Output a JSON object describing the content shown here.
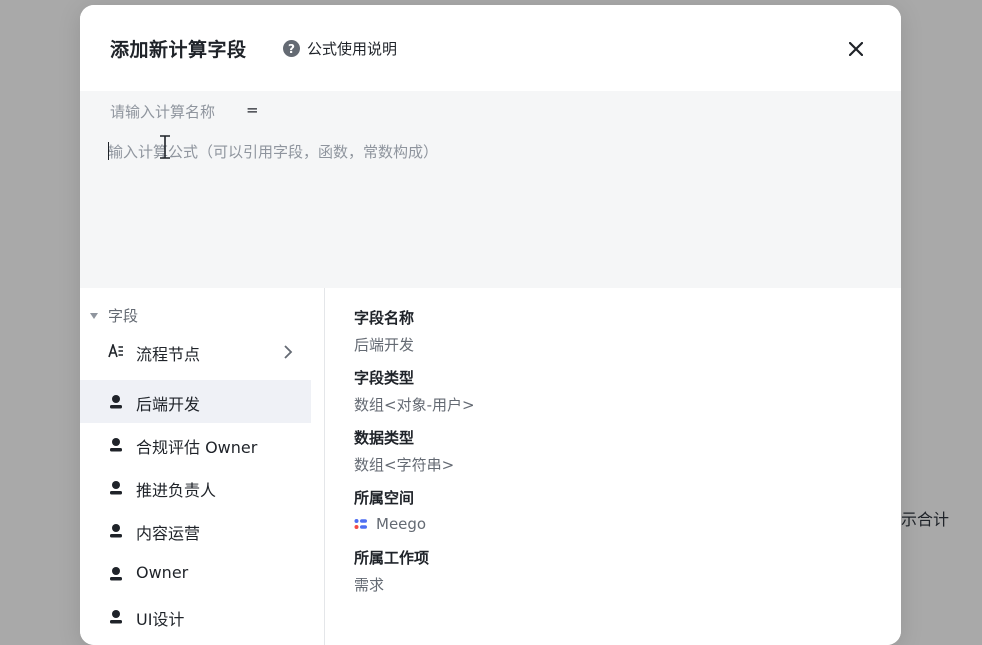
{
  "background": {
    "right_text": "示合计"
  },
  "modal": {
    "title": "添加新计算字段",
    "help": {
      "label": "公式使用说明",
      "icon": "question-circle-icon"
    },
    "close_icon": "close-icon"
  },
  "editor": {
    "name_placeholder": "请输入计算名称",
    "equals": "=",
    "formula_placeholder": "输入计算公式（可以引用字段，函数，常数构成）"
  },
  "field_list": {
    "section_label": "字段",
    "items": [
      {
        "label": "流程节点",
        "icon": "text-field-icon",
        "has_chevron": true
      },
      {
        "label": "后端开发",
        "icon": "person-icon",
        "selected": true
      },
      {
        "label": "合规评估 Owner",
        "icon": "person-icon"
      },
      {
        "label": "推进负责人",
        "icon": "person-icon"
      },
      {
        "label": "内容运营",
        "icon": "person-icon"
      },
      {
        "label": "Owner",
        "icon": "person-icon"
      },
      {
        "label": "UI设计",
        "icon": "person-icon"
      }
    ]
  },
  "details": {
    "field_name": {
      "label": "字段名称",
      "value": "后端开发"
    },
    "field_type": {
      "label": "字段类型",
      "value": "数组<对象-用户>"
    },
    "data_type": {
      "label": "数据类型",
      "value": "数组<字符串>"
    },
    "space": {
      "label": "所属空间",
      "value": "Meego",
      "icon": "meego-logo-icon"
    },
    "work_item": {
      "label": "所属工作项",
      "value": "需求"
    }
  },
  "colors": {
    "overlay": "#a9a9a9",
    "editor_bg": "#f5f6f7",
    "selected_bg": "#eff1f6",
    "text_primary": "#1f2329",
    "text_secondary": "#646a73",
    "meego_accent": "#4e6ef2"
  }
}
